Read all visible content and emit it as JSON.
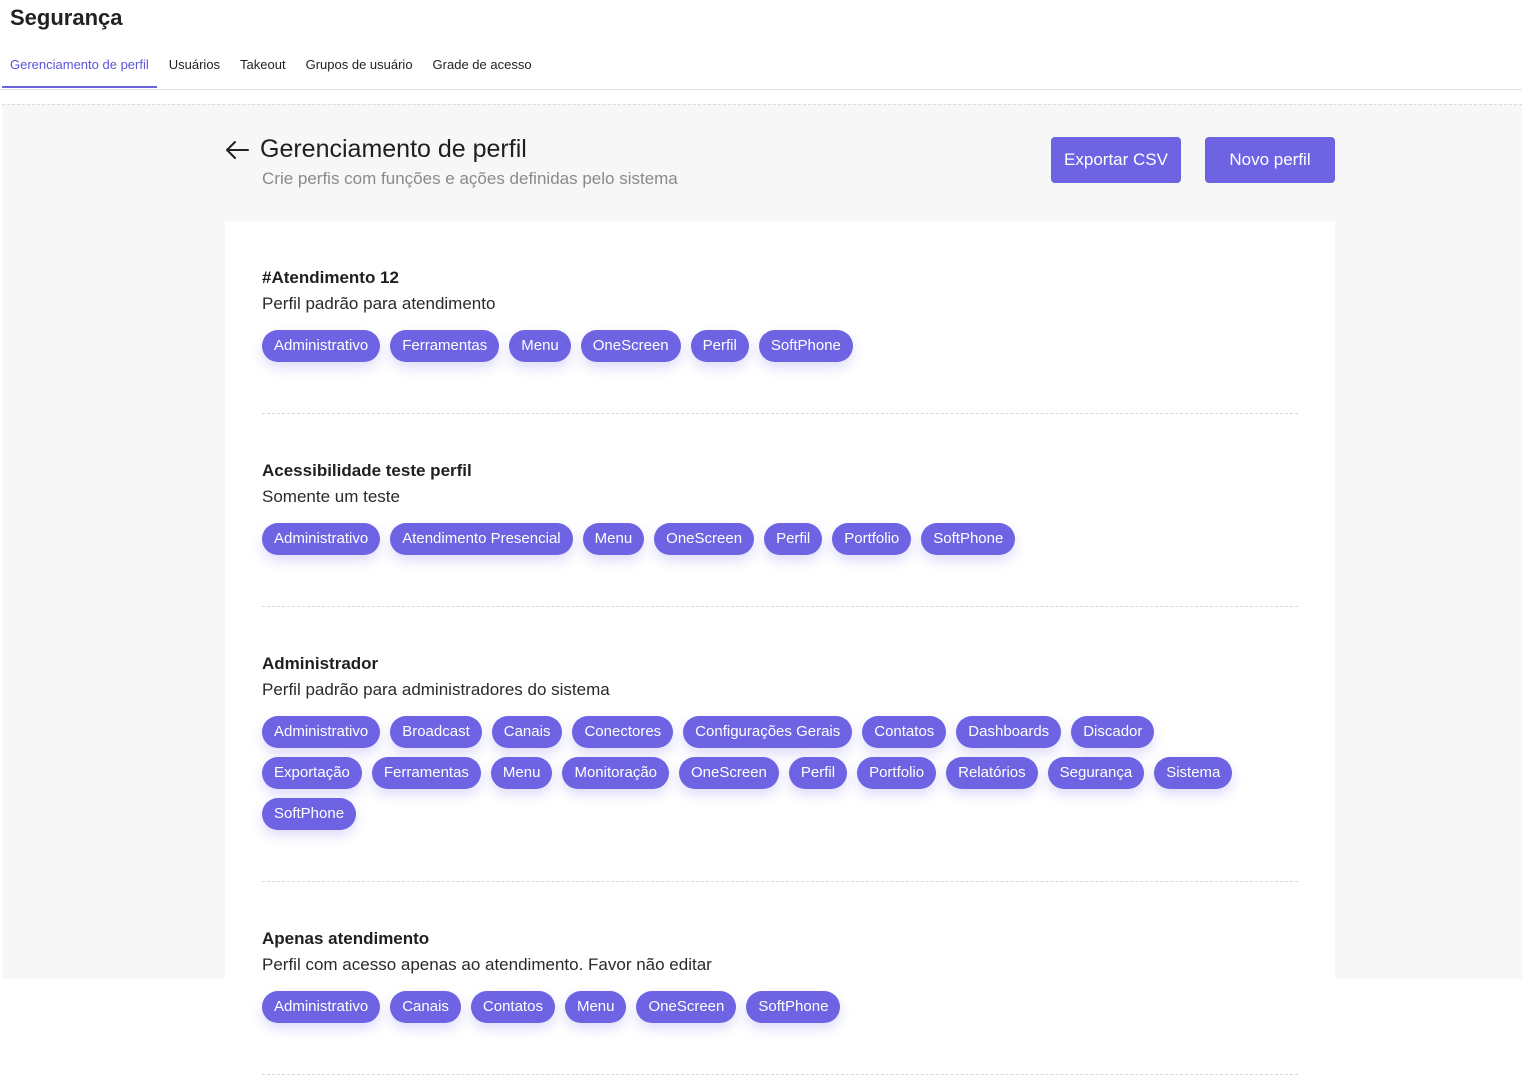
{
  "header": {
    "title": "Segurança",
    "tabs": [
      {
        "label": "Gerenciamento de perfil",
        "active": true
      },
      {
        "label": "Usuários",
        "active": false
      },
      {
        "label": "Takeout",
        "active": false
      },
      {
        "label": "Grupos de usuário",
        "active": false
      },
      {
        "label": "Grade de acesso",
        "active": false
      }
    ]
  },
  "page": {
    "title": "Gerenciamento de perfil",
    "subtitle": "Crie perfis com funções e ações definidas pelo sistema",
    "back_icon": "arrow-left-icon",
    "export_label": "Exportar CSV",
    "new_label": "Novo perfil"
  },
  "colors": {
    "accent": "#6d63e3",
    "active_tab": "#5b55d6",
    "background": "#f7f7f7"
  },
  "profiles": [
    {
      "name": "#Atendimento 12",
      "description": "Perfil padrão para atendimento",
      "tags": [
        "Administrativo",
        "Ferramentas",
        "Menu",
        "OneScreen",
        "Perfil",
        "SoftPhone"
      ]
    },
    {
      "name": "Acessibilidade teste perfil",
      "description": "Somente um teste",
      "tags": [
        "Administrativo",
        "Atendimento Presencial",
        "Menu",
        "OneScreen",
        "Perfil",
        "Portfolio",
        "SoftPhone"
      ]
    },
    {
      "name": "Administrador",
      "description": "Perfil padrão para administradores do sistema",
      "tags": [
        "Administrativo",
        "Broadcast",
        "Canais",
        "Conectores",
        "Configurações Gerais",
        "Contatos",
        "Dashboards",
        "Discador",
        "Exportação",
        "Ferramentas",
        "Menu",
        "Monitoração",
        "OneScreen",
        "Perfil",
        "Portfolio",
        "Relatórios",
        "Segurança",
        "Sistema",
        "SoftPhone"
      ]
    },
    {
      "name": "Apenas atendimento",
      "description": "Perfil com acesso apenas ao atendimento. Favor não editar",
      "tags": [
        "Administrativo",
        "Canais",
        "Contatos",
        "Menu",
        "OneScreen",
        "SoftPhone"
      ]
    }
  ]
}
